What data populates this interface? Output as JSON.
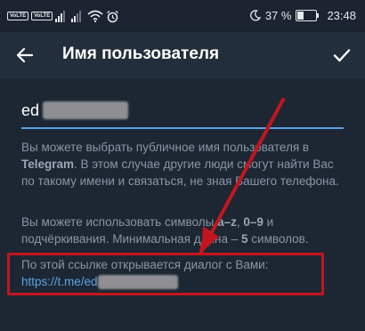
{
  "status_bar": {
    "volte1": "VoLTE",
    "volte2": "VoLTE",
    "battery_percent": "37 %",
    "time": "23:48",
    "icons": [
      "signal-icon",
      "wifi-icon",
      "alarm-icon",
      "moon-icon",
      "battery-icon"
    ]
  },
  "app_bar": {
    "title": "Имя пользователя",
    "back_icon": "arrow-left-icon",
    "done_icon": "checkmark-icon"
  },
  "form": {
    "username_value": "ed",
    "accent_color": "#5aa2e4"
  },
  "help": {
    "p1_a": "Вы можете выбрать публичное имя пользователя в ",
    "p1_brand": "Telegram",
    "p1_b": ". В этом случае другие люди смогут найти Вас по такому имени и связаться, не зная Вашего телефона.",
    "p2_a": "Вы можете использовать символы ",
    "p2_r1": "a–z",
    "p2_sep1": ", ",
    "p2_r2": "0–9",
    "p2_b": " и подчёркивания. Минимальная длина – ",
    "p2_min": "5",
    "p2_c": " символов."
  },
  "link": {
    "text": "По этой ссылке открывается диалог с Вами:",
    "url": "https://t.me/ed"
  },
  "annotation": {
    "highlight_color": "#c1161f"
  }
}
